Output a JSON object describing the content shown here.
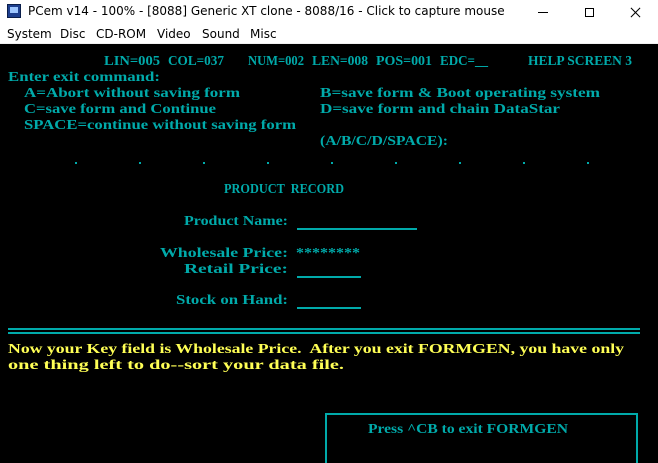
{
  "window": {
    "title": "PCem v14 - 100% - [8088] Generic XT clone - 8088/16 - Click to capture mouse",
    "icon": "pcem-app-icon"
  },
  "menu": [
    "System",
    "Disc",
    "CD-ROM",
    "Video",
    "Sound",
    "Misc"
  ],
  "status_line": {
    "lin": "LIN=005",
    "col": "COL=037",
    "num": "NUM=002",
    "len": "LEN=008",
    "pos": "POS=001",
    "edc": "EDC=__",
    "help": "HELP SCREEN 3"
  },
  "exit_menu": {
    "prompt": "Enter exit command:",
    "a": "A=Abort without saving form",
    "b": "B=save form & Boot operating system",
    "c": "C=save form and Continue",
    "d": "D=save form and chain DataStar",
    "space": "SPACE=continue without saving form",
    "choice": "(A/B/C/D/SPACE):"
  },
  "form": {
    "title": "PRODUCT  RECORD",
    "product_name_label": "Product Name:",
    "wholesale_label": "Wholesale Price:",
    "wholesale_value": "********",
    "retail_label": "Retail Price:",
    "stock_label": "Stock on Hand:"
  },
  "message": {
    "line1": "Now your Key field is Wholesale Price.  After you exit FORMGEN, you have only",
    "line2": "one thing left to do--sort your data file."
  },
  "exit_hint": "Press ^CB to exit FORMGEN",
  "colors": {
    "cyan": "#00aaaa",
    "yellow": "#ffff55",
    "background": "#000000"
  }
}
